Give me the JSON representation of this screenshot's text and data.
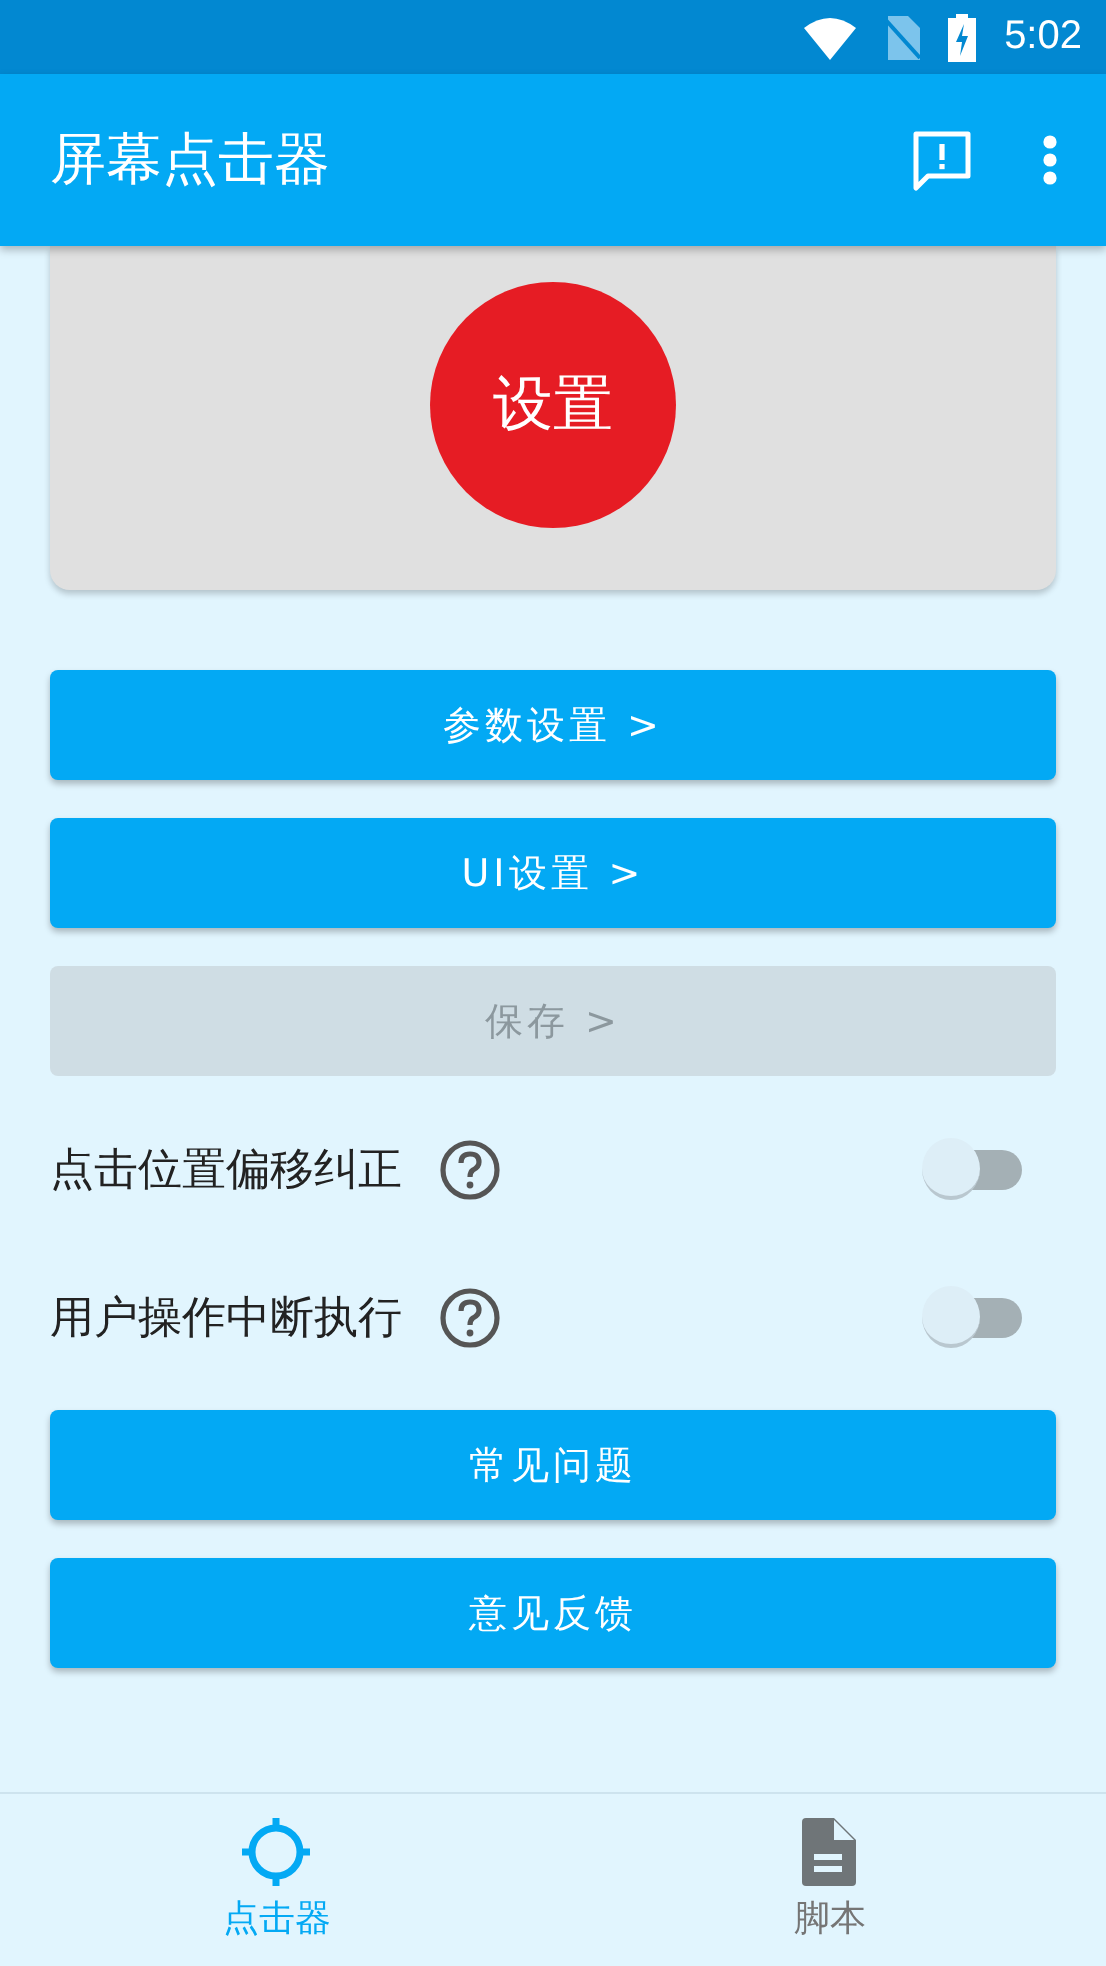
{
  "status_bar": {
    "time": "5:02"
  },
  "app_bar": {
    "title": "屏幕点击器"
  },
  "card": {
    "button": "设置"
  },
  "items": [
    {
      "kind": "button",
      "label": "参数设置 >",
      "disabled": false
    },
    {
      "kind": "button",
      "label": "UI设置 >",
      "disabled": false
    },
    {
      "kind": "button",
      "label": "保存 >",
      "disabled": true
    },
    {
      "kind": "switch",
      "label": "点击位置偏移纠正",
      "on": false
    },
    {
      "kind": "switch",
      "label": "用户操作中断执行",
      "on": false
    },
    {
      "kind": "button",
      "label": "常见问题",
      "disabled": false
    },
    {
      "kind": "button",
      "label": "意见反馈",
      "disabled": false
    }
  ],
  "bottom_nav": [
    {
      "label": "点击器",
      "selected": true
    },
    {
      "label": "脚本",
      "selected": false
    }
  ]
}
